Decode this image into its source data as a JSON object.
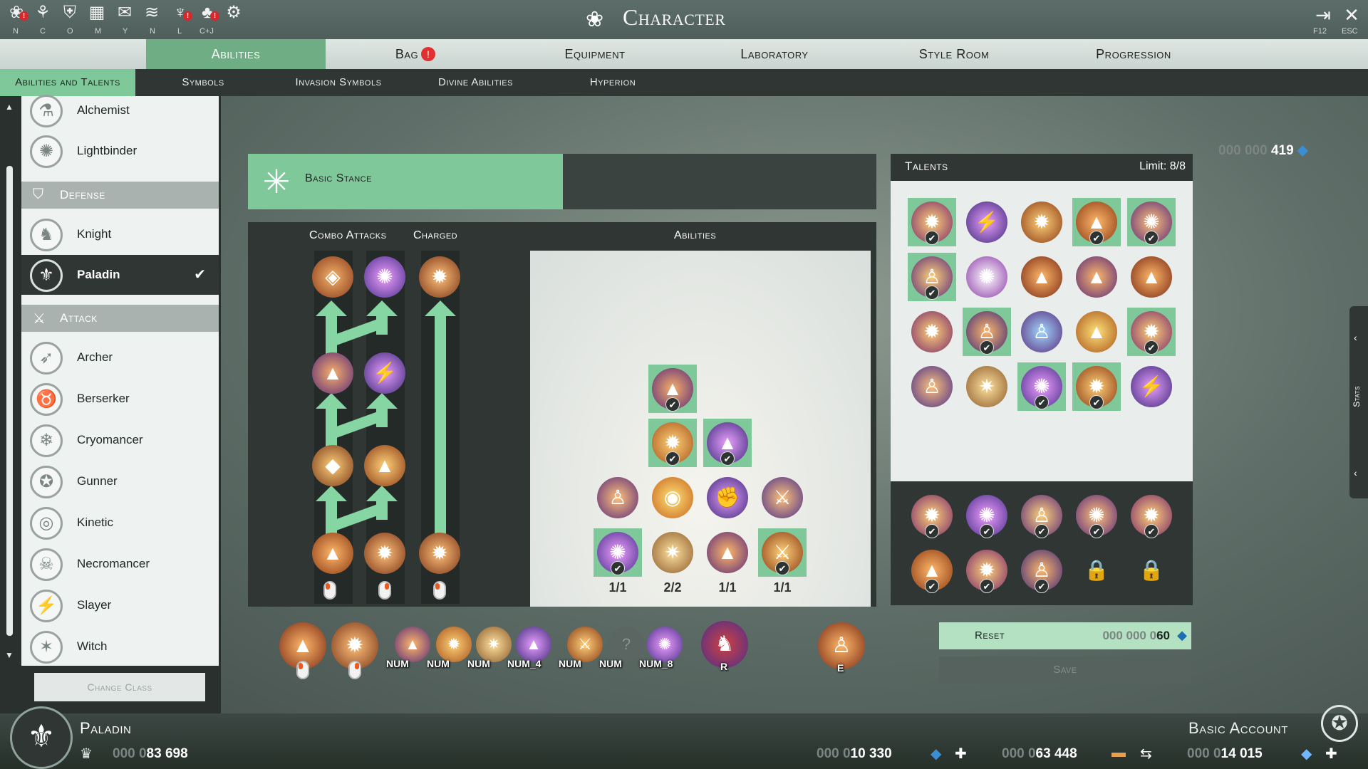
{
  "window": {
    "title": "Character",
    "exit_key": "F12",
    "close_key": "ESC"
  },
  "quickbar": [
    {
      "icon": "character-icon",
      "key": "N",
      "alert": true
    },
    {
      "icon": "skills-icon",
      "key": "C",
      "alert": false
    },
    {
      "icon": "guild-icon",
      "key": "O",
      "alert": false
    },
    {
      "icon": "map-icon",
      "key": "M",
      "alert": false
    },
    {
      "icon": "chat-icon",
      "key": "Y",
      "alert": false
    },
    {
      "icon": "mount-icon",
      "key": "N",
      "alert": false
    },
    {
      "icon": "ranking-icon",
      "key": "L",
      "alert": true
    },
    {
      "icon": "social-icon",
      "key": "C+J",
      "alert": true
    },
    {
      "icon": "settings-gear-icon",
      "key": "",
      "alert": false
    }
  ],
  "tabs": [
    "Abilities",
    "Bag",
    "Equipment",
    "Laboratory",
    "Style Room",
    "Progression"
  ],
  "bag_badge": "!",
  "subtabs": [
    "Abilities and Talents",
    "Symbols",
    "Invasion Symbols",
    "Divine Abilities",
    "Hyperion"
  ],
  "top_currency": {
    "dim": "000 000 ",
    "value": "419"
  },
  "sidebar": {
    "support": [
      {
        "label": "Alchemist",
        "icon": "alchemist-icon"
      },
      {
        "label": "Lightbinder",
        "icon": "lightbinder-icon"
      }
    ],
    "defense_label": "Defense",
    "defense": [
      {
        "label": "Knight",
        "icon": "knight-icon"
      },
      {
        "label": "Paladin",
        "icon": "paladin-icon",
        "selected": true
      }
    ],
    "attack_label": "Attack",
    "attack": [
      {
        "label": "Archer",
        "icon": "archer-icon"
      },
      {
        "label": "Berserker",
        "icon": "berserker-icon"
      },
      {
        "label": "Cryomancer",
        "icon": "cryomancer-icon"
      },
      {
        "label": "Gunner",
        "icon": "gunner-icon"
      },
      {
        "label": "Kinetic",
        "icon": "kinetic-icon"
      },
      {
        "label": "Necromancer",
        "icon": "necromancer-icon"
      },
      {
        "label": "Slayer",
        "icon": "slayer-icon"
      },
      {
        "label": "Witch",
        "icon": "witch-icon"
      }
    ],
    "change_class": "Change Class"
  },
  "stance": {
    "label": "Basic Stance"
  },
  "combo": {
    "combo_label": "Combo Attacks",
    "charged_label": "Charged",
    "abilities_label": "Abilities",
    "ability_counts": [
      "1/1",
      "2/2",
      "1/1",
      "1/1"
    ]
  },
  "talents": {
    "title": "Talents",
    "limit": "Limit: 8/8"
  },
  "reset": {
    "label": "Reset",
    "dim": "000 000 0",
    "value": "60"
  },
  "save": {
    "label": "Save"
  },
  "hotbar_keys": [
    "NUM",
    "NUM",
    "NUM",
    "NUM_4",
    "NUM",
    "NUM",
    "NUM_8",
    "R",
    "E"
  ],
  "stats_tab": "Stats",
  "footer": {
    "class_name": "Paladin",
    "account": "Basic Account",
    "gearscore": {
      "dim": "000 0",
      "value": "83 698"
    },
    "currencies": [
      {
        "dim": "000 0",
        "value": "10 330",
        "icon": "crystal-icon"
      },
      {
        "dim": "000 0",
        "value": "63 448",
        "icon": "flag-icon"
      },
      {
        "dim": "000 0",
        "value": "14 015",
        "icon": "diamond-icon"
      }
    ]
  },
  "colors": {
    "accent": "#7fc89a",
    "panel": "#2f3634",
    "alert": "#d8262b"
  }
}
